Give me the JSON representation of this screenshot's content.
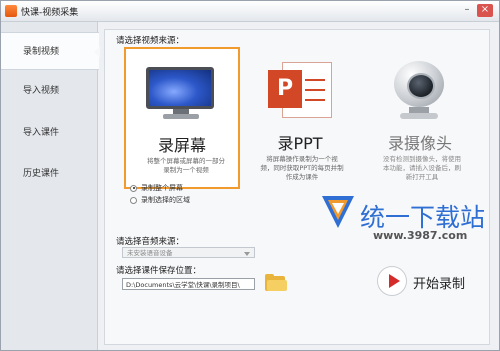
{
  "window": {
    "title": "快课-视频采集",
    "minimize_icon": "minimize-icon",
    "close_icon": "close-icon"
  },
  "sidebar": {
    "items": [
      {
        "label": "录制视频",
        "active": true
      },
      {
        "label": "导入视频",
        "active": false
      },
      {
        "label": "导入课件",
        "active": false
      },
      {
        "label": "历史课件",
        "active": false
      }
    ]
  },
  "source": {
    "heading": "请选择视频来源：",
    "cards": [
      {
        "title": "录屏幕",
        "desc": "将整个屏幕或屏幕的一部分录制为一个视频",
        "icon": "monitor-icon",
        "selected": true
      },
      {
        "title": "录PPT",
        "desc": "将屏幕操作录制为一个视频，同时获取PPT的每页并制作成为课件",
        "icon": "ppt-icon",
        "selected": false
      },
      {
        "title": "录摄像头",
        "desc": "没有检测到摄像头，将使用本功能，请插入设备后，刷新打开工具",
        "icon": "webcam-icon",
        "selected": false
      }
    ]
  },
  "record_mode": {
    "options": [
      {
        "label": "录制整个屏幕",
        "checked": true
      },
      {
        "label": "录制选择的区域",
        "checked": false
      }
    ]
  },
  "audio": {
    "heading": "请选择音频来源：",
    "selected": "未安装语音设备"
  },
  "save": {
    "heading": "请选择课件保存位置：",
    "path": "D:\\Documents\\云学堂\\快课\\录制项目\\",
    "folder_icon": "folder-icon"
  },
  "watermark": {
    "text": "统一下载站",
    "url": "www.3987.com"
  },
  "start": {
    "label": "开始录制",
    "icon": "play-icon"
  },
  "colors": {
    "selected_border": "#f19a2e",
    "accent_red": "#d62b2b",
    "watermark_blue": "#2f6fd3"
  }
}
